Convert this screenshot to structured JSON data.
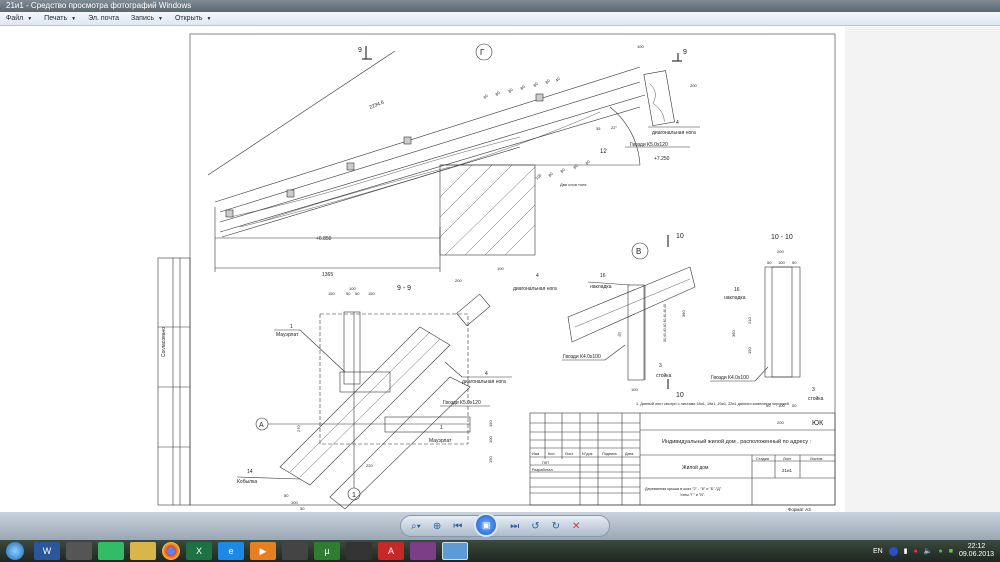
{
  "window": {
    "title": "21и1 - Средство просмотра фотографий Windows"
  },
  "menu": [
    {
      "label": "Файл",
      "arrow": true
    },
    {
      "label": "Печать",
      "arrow": true
    },
    {
      "label": "Эл. почта",
      "arrow": false
    },
    {
      "label": "Запись",
      "arrow": true
    },
    {
      "label": "Открыть",
      "arrow": true
    }
  ],
  "drawing": {
    "side_strip": "Согласовано",
    "node_g": {
      "mark": "Г",
      "section_mark": "9",
      "dim_total": "2234.6",
      "dims_top": [
        "60",
        "80",
        "80",
        "80",
        "80",
        "80",
        "40"
      ],
      "dims_bottom": [
        "100",
        "80",
        "80",
        "80",
        "60"
      ],
      "angle": "22°",
      "dim_35": "35",
      "label_4_num": "4",
      "label_4": "диагональная нога",
      "nails": "Гвозди К5.0х120",
      "label_12": "12",
      "level_top": "+7.250",
      "level_bottom": "+6.850",
      "dim_1365": "1365",
      "pad_label": "Два слоя толя",
      "sec_w": "100",
      "sec_h": "200"
    },
    "section_99": {
      "title": "9 - 9",
      "dim_100": "100",
      "dims": [
        "150",
        "50",
        "50",
        "150"
      ],
      "label_1_num": "1",
      "mauerlat": "Мауэрлат",
      "label_4_num": "4",
      "label_4": "диагональная нога",
      "nails": "Гвозди К5.0х120",
      "dim_270": "270",
      "dims_right": [
        "150",
        "100",
        "150"
      ],
      "label_1b_num": "1",
      "mauerlat_b": "Мауэрлат",
      "label_14_num": "14",
      "kobylka": "Кобылка",
      "dim_220": "220",
      "dims_bottom": [
        "50",
        "100",
        "50"
      ],
      "axis_a": "А",
      "axis_1": "1",
      "sec_w": "200",
      "sec_h": "100"
    },
    "node_v": {
      "mark": "В",
      "section_mark": "10",
      "label_4_num": "4",
      "label_4": "диагональная нога",
      "label_16_num": "16",
      "nakladka": "накладка",
      "nails": "Гвозди К4.0х100",
      "label_3_num": "3",
      "stoyka": "стойка",
      "dim_360": "360",
      "dim_100": "100",
      "dim_30": "30",
      "dim_chain": "30,40,40,40,40,40,40,40"
    },
    "section_1010": {
      "title": "10 - 10",
      "dim_200": "200",
      "dims_top": [
        "50",
        "100",
        "50"
      ],
      "label_16_num": "16",
      "nakladka": "накладка",
      "dim_360": "360",
      "dim_210": "210",
      "dim_150": "150",
      "nails": "Гвозди К4.0х100",
      "label_3_num": "3",
      "stoyka": "стойка",
      "dims_bottom": [
        "50",
        "100",
        "50"
      ],
      "dim_200b": "200"
    },
    "note": "1. Данный лист смотри с листами   18и1, 19и1, 20и1, 22и1 данного комплекта чертежей",
    "title_block": {
      "code": "ЮК",
      "project": "Индивидуальный  жилой дом , расположенный по адресу :",
      "cols": [
        "Изм",
        "Кол.",
        "Лист",
        "N°док.",
        "Подпись",
        "Дата"
      ],
      "gip": "ГКП",
      "developer": "Разработал",
      "building": "Жилой дом",
      "stage_h": "Стадия",
      "sheet_h": "Лист",
      "sheets_h": "Листов",
      "sheet": "21и1",
      "desc1": "Деревянная крыша  в осях  \"2\" - \"6\" и \"Б\"-\"Д\".",
      "desc2": "Узлы \"Г\" и \"В\".",
      "format": "Формат А3"
    }
  },
  "controls": {
    "zoom": "⌕▾",
    "fit": "⊕",
    "prev": "⏮",
    "slideshow": "▣",
    "next": "⏭",
    "rotl": "↺",
    "rotr": "↻",
    "delete": "✕"
  },
  "tray": {
    "lang": "EN",
    "time": "22:12",
    "date": "09.06.2013"
  },
  "colors": {
    "taskbar": "#2a342c",
    "accent": "#1d58c7"
  }
}
